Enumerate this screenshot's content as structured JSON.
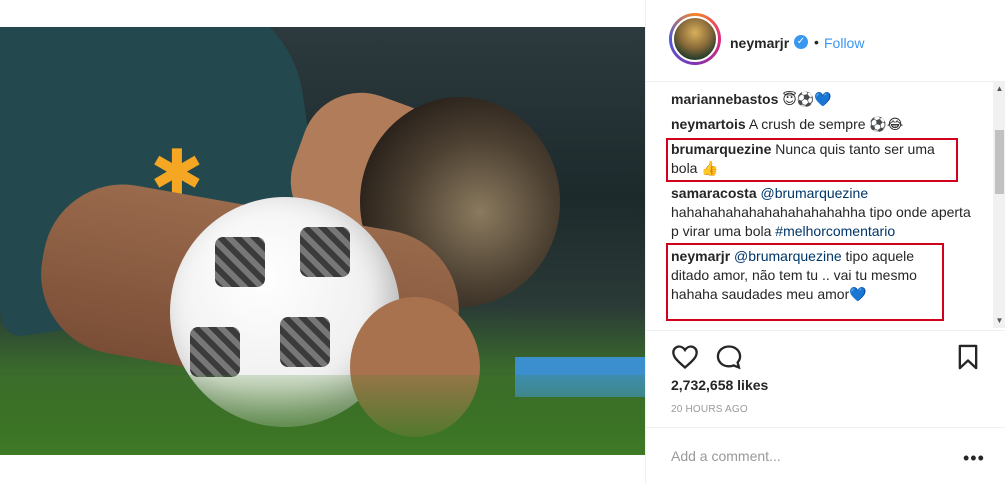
{
  "post": {
    "author": "neymarjr",
    "follow_label": "Follow",
    "dot": "•",
    "verified_glyph": "✓"
  },
  "comments": [
    {
      "user": "mariannebastos",
      "text": " 😇⚽💙"
    },
    {
      "user": "neymartois",
      "text": " A crush de sempre ⚽😂"
    },
    {
      "user": "brumarquezine",
      "text": " Nunca quis tanto ser uma bola 👍"
    },
    {
      "user": "samaracosta",
      "mention": " @brumarquezine",
      "text": " hahahahahahahahahahahahha tipo onde aperta p virar uma bola ",
      "tag": "#melhorcomentario"
    },
    {
      "user": "neymarjr",
      "mention": " @brumarquezine",
      "text": " tipo aquele ditado amor, não tem tu .. vai tu mesmo hahaha saudades meu amor💙"
    }
  ],
  "likes_text": "2,732,658 likes",
  "timestamp": "20 HOURS AGO",
  "add_comment_placeholder": "Add a comment...",
  "more_glyph": "•••",
  "colors": {
    "accent": "#3897f0",
    "highlight": "#d0021b",
    "link": "#003569"
  },
  "icons": [
    "heart-icon",
    "comment-icon",
    "bookmark-icon",
    "verified-icon",
    "more-icon"
  ]
}
